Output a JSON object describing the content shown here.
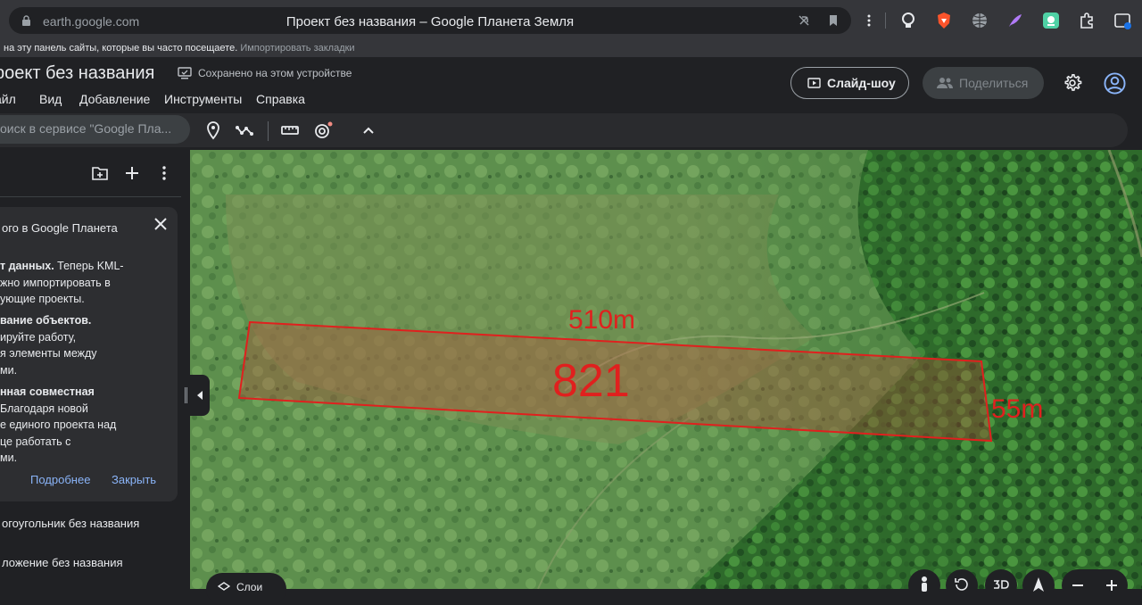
{
  "browser": {
    "url": "earth.google.com",
    "tab_title": "Проект без названия – Google Планета Земля",
    "bookmarks_hint": "на эту панель сайты, которые вы часто посещаете.",
    "bookmarks_import": "Импортировать закладки"
  },
  "app": {
    "project_title": "роект без названия",
    "saved_status": "Сохранено на этом устройстве",
    "menu": [
      "айл",
      "Вид",
      "Добавление",
      "Инструменты",
      "Справка"
    ],
    "slideshow_label": "Слайд-шоу",
    "share_label": "Поделиться",
    "search_placeholder": "оиск в сервисе \"Google Пла..."
  },
  "panel": {
    "card": {
      "title": "ого в Google Планета",
      "para1_bold": "т данных.",
      "para1_rest": " Теперь KML-",
      "para1_lines": [
        "жно импортировать в",
        "ующие проекты."
      ],
      "para2_bold": "вание объектов.",
      "para2_lines": [
        "ируйте работу,",
        "я элементы между",
        "ми."
      ],
      "para3_bold": "нная совместная",
      "para3_lines": [
        "Благодаря новой",
        "е единого проекта над",
        "це работать с",
        "ми."
      ],
      "more_link": "Подробнее",
      "close_link": "Закрыть"
    },
    "items": [
      "огоугольник без названия",
      "ложение без названия"
    ]
  },
  "map": {
    "measure_top": "510m",
    "measure_side": "55m",
    "area_label": "821",
    "layers_label": "Слои",
    "accent_color": "#e0201e"
  }
}
